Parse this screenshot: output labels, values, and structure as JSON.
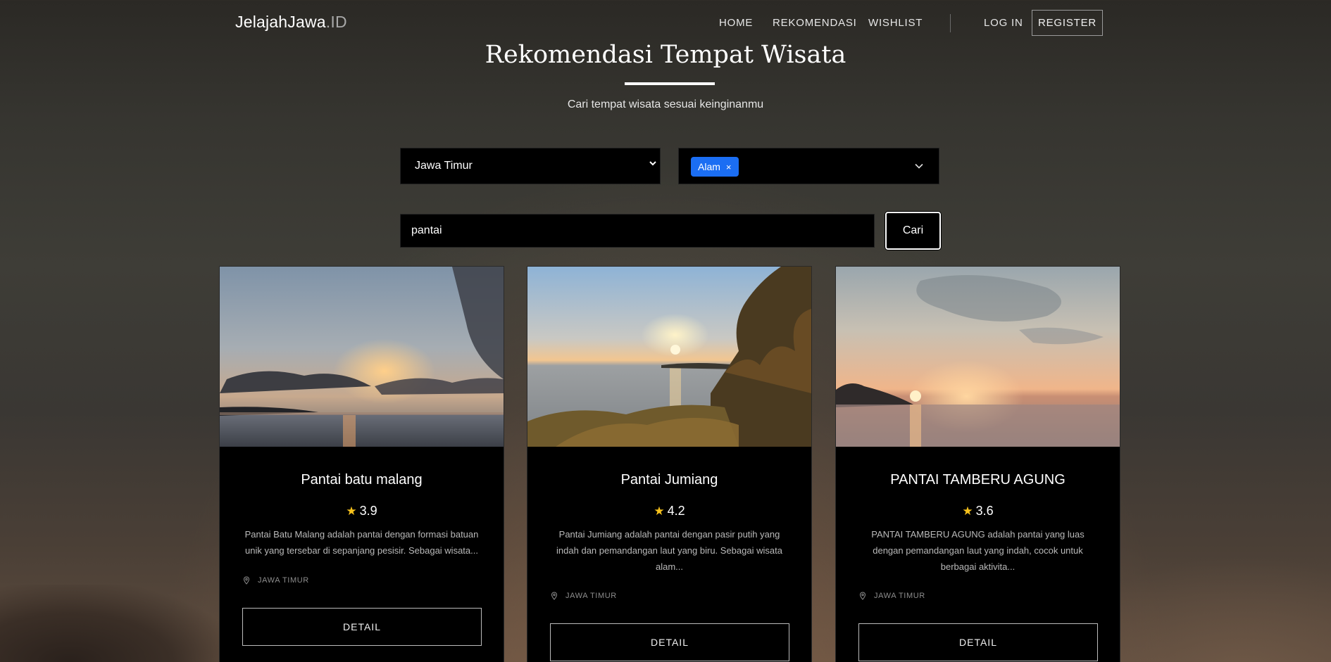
{
  "navbar": {
    "brand_main": "JelajahJawa",
    "brand_tld": ".ID",
    "links": [
      "HOME",
      "REKOMENDASI",
      "WISHLIST"
    ],
    "login": "LOG IN",
    "register": "REGISTER"
  },
  "hero": {
    "title": "Rekomendasi Tempat Wisata",
    "subtitle": "Cari tempat wisata sesuai keinginanmu"
  },
  "filters": {
    "province_value": "Jawa Timur",
    "category_tag": "Alam",
    "tag_remove": "×",
    "search_value": "pantai",
    "search_button": "Cari"
  },
  "cards": [
    {
      "title": "Pantai batu malang",
      "rating": "3.9",
      "description": "Pantai Batu Malang adalah pantai dengan formasi batuan unik yang tersebar di sepanjang pesisir. Sebagai wisata...",
      "location": "JAWA TIMUR",
      "detail": "DETAIL",
      "image": "sunset-beach-cloudy"
    },
    {
      "title": "Pantai Jumiang",
      "rating": "4.2",
      "description": "Pantai Jumiang adalah pantai dengan pasir putih yang indah dan pemandangan laut yang biru. Sebagai wisata alam...",
      "location": "JAWA TIMUR",
      "detail": "DETAIL",
      "image": "sunset-cliff-tree"
    },
    {
      "title": "PANTAI TAMBERU AGUNG",
      "rating": "3.6",
      "description": "PANTAI TAMBERU AGUNG adalah pantai yang luas dengan pemandangan laut yang indah, cocok untuk berbagai aktivita...",
      "location": "JAWA TIMUR",
      "detail": "DETAIL",
      "image": "sunset-horizon"
    }
  ],
  "colors": {
    "accent_tag": "#1b6ef3",
    "star": "#f7c21c",
    "card_bg": "#000000"
  }
}
